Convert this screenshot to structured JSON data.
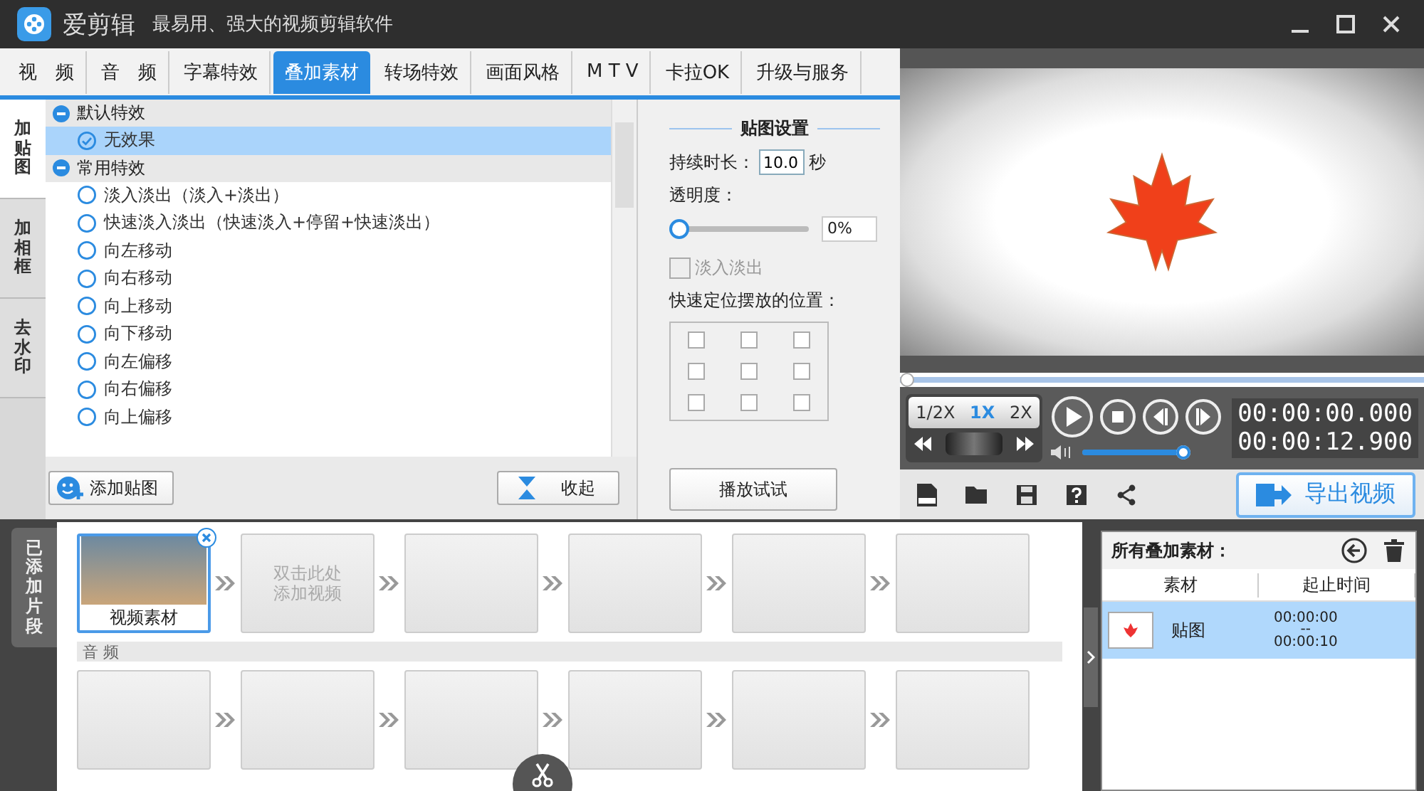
{
  "app": {
    "name": "爱剪辑",
    "tagline": "最易用、强大的视频剪辑软件"
  },
  "tabs": [
    {
      "label": "视　频",
      "selected": false
    },
    {
      "label": "音　频",
      "selected": false
    },
    {
      "label": "字幕特效",
      "selected": false
    },
    {
      "label": "叠加素材",
      "selected": true
    },
    {
      "label": "转场特效",
      "selected": false
    },
    {
      "label": "画面风格",
      "selected": false
    },
    {
      "label": "M T V",
      "selected": false
    },
    {
      "label": "卡拉OK",
      "selected": false
    },
    {
      "label": "升级与服务",
      "selected": false
    }
  ],
  "side_tabs": [
    {
      "label": "加贴图",
      "selected": true
    },
    {
      "label": "加相框",
      "selected": false
    },
    {
      "label": "去水印",
      "selected": false
    }
  ],
  "effect_groups": [
    {
      "label": "默认特效",
      "expanded": true,
      "children": [
        {
          "label": "无效果",
          "selected": true
        }
      ]
    },
    {
      "label": "常用特效",
      "expanded": true,
      "children": [
        {
          "label": "淡入淡出（淡入+淡出）",
          "selected": false
        },
        {
          "label": "快速淡入淡出（快速淡入+停留+快速淡出）",
          "selected": false
        },
        {
          "label": "向左移动",
          "selected": false
        },
        {
          "label": "向右移动",
          "selected": false
        },
        {
          "label": "向上移动",
          "selected": false
        },
        {
          "label": "向下移动",
          "selected": false
        },
        {
          "label": "向左偏移",
          "selected": false
        },
        {
          "label": "向右偏移",
          "selected": false
        },
        {
          "label": "向上偏移",
          "selected": false
        }
      ]
    }
  ],
  "list_buttons": {
    "add": "添加贴图",
    "collapse": "收起"
  },
  "sticker_settings": {
    "title": "贴图设置",
    "duration_label": "持续时长：",
    "duration": "10.0",
    "unit": "秒",
    "opacity_label": "透明度：",
    "opacity": {
      "level": 0,
      "reading": "0%"
    },
    "fade": {
      "label": "淡入淡出",
      "checked": false,
      "disabled": true
    },
    "position_label": "快速定位摆放的位置：",
    "positions": [
      {
        "checked": false
      },
      {
        "checked": false
      },
      {
        "checked": false
      },
      {
        "checked": false
      },
      {
        "checked": false
      },
      {
        "checked": false
      },
      {
        "checked": false
      },
      {
        "checked": false
      },
      {
        "checked": false
      }
    ],
    "try_button": "播放试试"
  },
  "player": {
    "progress": {
      "level": 0
    },
    "speeds": [
      {
        "label": "1/2X",
        "selected": false
      },
      {
        "label": "1X",
        "selected": true
      },
      {
        "label": "2X",
        "selected": false
      }
    ],
    "volume": {
      "level": 1
    },
    "time_current": "00:00:00.000",
    "time_total": "00:00:12.900",
    "export_button": "导出视频"
  },
  "timeline": {
    "label": "已添加片段",
    "clips": [
      {
        "kind": "video",
        "label": "视频素材",
        "selected": true
      },
      {
        "kind": "hint",
        "label": "双击此处添加视频",
        "selected": false
      },
      {
        "kind": "empty",
        "selected": false
      },
      {
        "kind": "empty",
        "selected": false
      },
      {
        "kind": "empty",
        "selected": false
      },
      {
        "kind": "empty",
        "selected": false
      }
    ],
    "audio_label": "音 频",
    "audio_slots": [
      {
        "kind": "empty"
      },
      {
        "kind": "empty"
      },
      {
        "kind": "empty"
      },
      {
        "kind": "empty"
      },
      {
        "kind": "empty"
      },
      {
        "kind": "empty"
      }
    ]
  },
  "overlays": {
    "title": "所有叠加素材：",
    "columns": [
      "素材",
      "起止时间"
    ],
    "rows": [
      {
        "name": "贴图",
        "start": "00:00:00",
        "separator": "--",
        "end": "00:00:10",
        "selected": true
      }
    ]
  }
}
